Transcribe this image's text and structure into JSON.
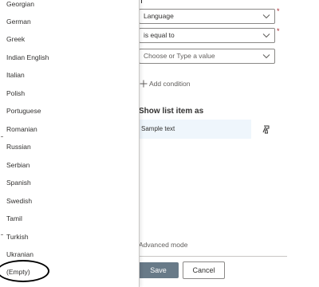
{
  "dropdown": {
    "items": [
      "Georgian",
      "German",
      "Greek",
      "Indian English",
      "Italian",
      "Polish",
      "Portuguese",
      "Romanian",
      "Russian",
      "Serbian",
      "Spanish",
      "Swedish",
      "Tamil",
      "Turkish",
      "Ukranian",
      "(Empty)"
    ]
  },
  "condition": {
    "field_value": "Language",
    "operator_value": "is equal to",
    "value_placeholder": "Choose or Type a value",
    "required_marker": "*",
    "add_condition_label": "Add condition"
  },
  "show_as": {
    "title": "Show list item as",
    "sample_text": "Sample text"
  },
  "footer": {
    "advanced_mode_label": "Advanced mode",
    "save_label": "Save",
    "cancel_label": "Cancel"
  },
  "colors": {
    "save_button": "#687a88",
    "sample_background": "#eff6fc",
    "required_marker": "#a4262c"
  }
}
